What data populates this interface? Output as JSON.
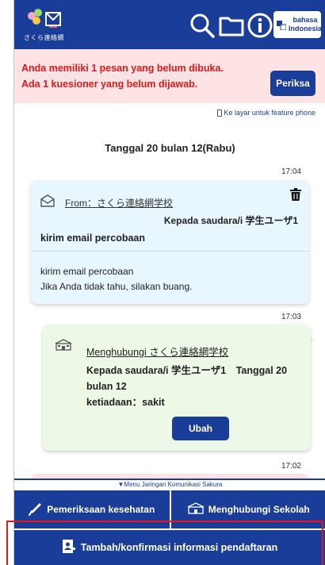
{
  "header": {
    "logo_text": "さくら連絡網",
    "search_icon": "search-icon",
    "folder_icon": "folder-icon",
    "info_icon": "info-icon",
    "language_line1": "bahasa",
    "language_line2": "Indonesia"
  },
  "notice": {
    "line1": "Anda memiliki 1 pesan yang belum dibuka.",
    "line2": "Ada 1 kuesioner yang belum dijawab.",
    "button_label": "Periksa"
  },
  "feature_phone_link": "Ke layar untuk feature phone",
  "date_heading": "Tanggal 20 bulan 12(Rabu)",
  "messages": [
    {
      "time": "17:04",
      "from": "From：さくら連絡網学校",
      "to": "Kepada saudara/i 学生ユーザ1",
      "subject": "kirim email percobaan",
      "body_line1": "kirim email percobaan",
      "body_line2": "Jika Anda tidak tahu, silakan buang."
    },
    {
      "time": "17:03",
      "contact": "Menghubungi さくら連絡網学校",
      "body": "Kepada saudara/i 学生ユーザ1　Tanggal 20 bulan 12",
      "body_line2": "ketiadaan：sakit",
      "button_label": "Ubah"
    },
    {
      "time": "17:02"
    }
  ],
  "bottom_menu": {
    "label": "▼Menu Jaringan Komunikasi Sakura",
    "health_check": "Pemeriksaan kesehatan",
    "contact_school": "Menghubungi Sekolah",
    "registration": "Tambah/konfirmasi informasi pendaftaran"
  },
  "colors": {
    "primary": "#1a3d99",
    "notice_bg": "#fde3e3",
    "notice_text": "#e0181b",
    "mail_card": "#e8f7fd",
    "contact_card": "#eef8e6"
  }
}
